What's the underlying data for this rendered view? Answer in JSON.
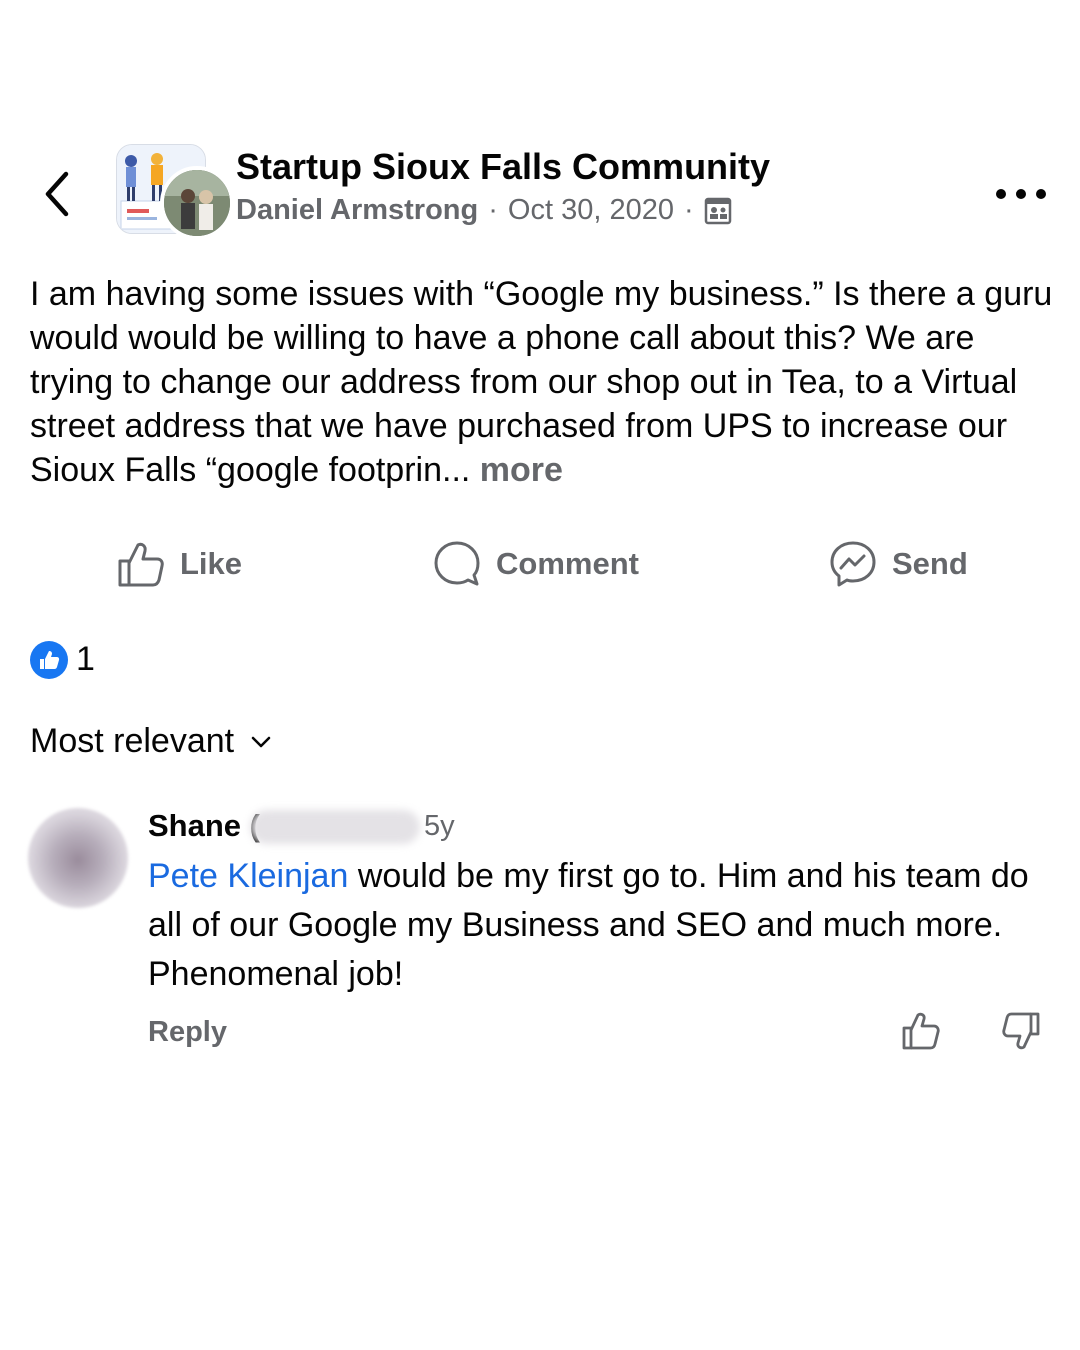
{
  "header": {
    "group_name": "Startup Sioux Falls Community",
    "author": "Daniel Armstrong",
    "separator": "·",
    "date": "Oct 30, 2020",
    "icons": {
      "back": "chevron-left-icon",
      "privacy": "members-icon",
      "more": "more-options-icon"
    }
  },
  "post": {
    "text": "I am having some issues with “Google my business.” Is there a guru would would be willing to have a phone call about this? We are trying to change our address from our shop out in Tea, to a Virtual street address that we have purchased from UPS to increase our Sioux Falls “google footprin... ",
    "see_more": "more"
  },
  "actions": {
    "like": "Like",
    "comment": "Comment",
    "send": "Send"
  },
  "reactions": {
    "count": "1"
  },
  "sort": {
    "label": "Most relevant"
  },
  "comment": {
    "author": "Shane (",
    "time": "5y",
    "mention": "Pete Kleinjan",
    "text": " would be my first go to.  Him and his team do all of our Google my Business and SEO and much more.  Phenomenal job!",
    "reply": "Reply"
  },
  "colors": {
    "accent": "#1877f2",
    "secondary_text": "#65676b",
    "mention": "#1a6ae0"
  }
}
